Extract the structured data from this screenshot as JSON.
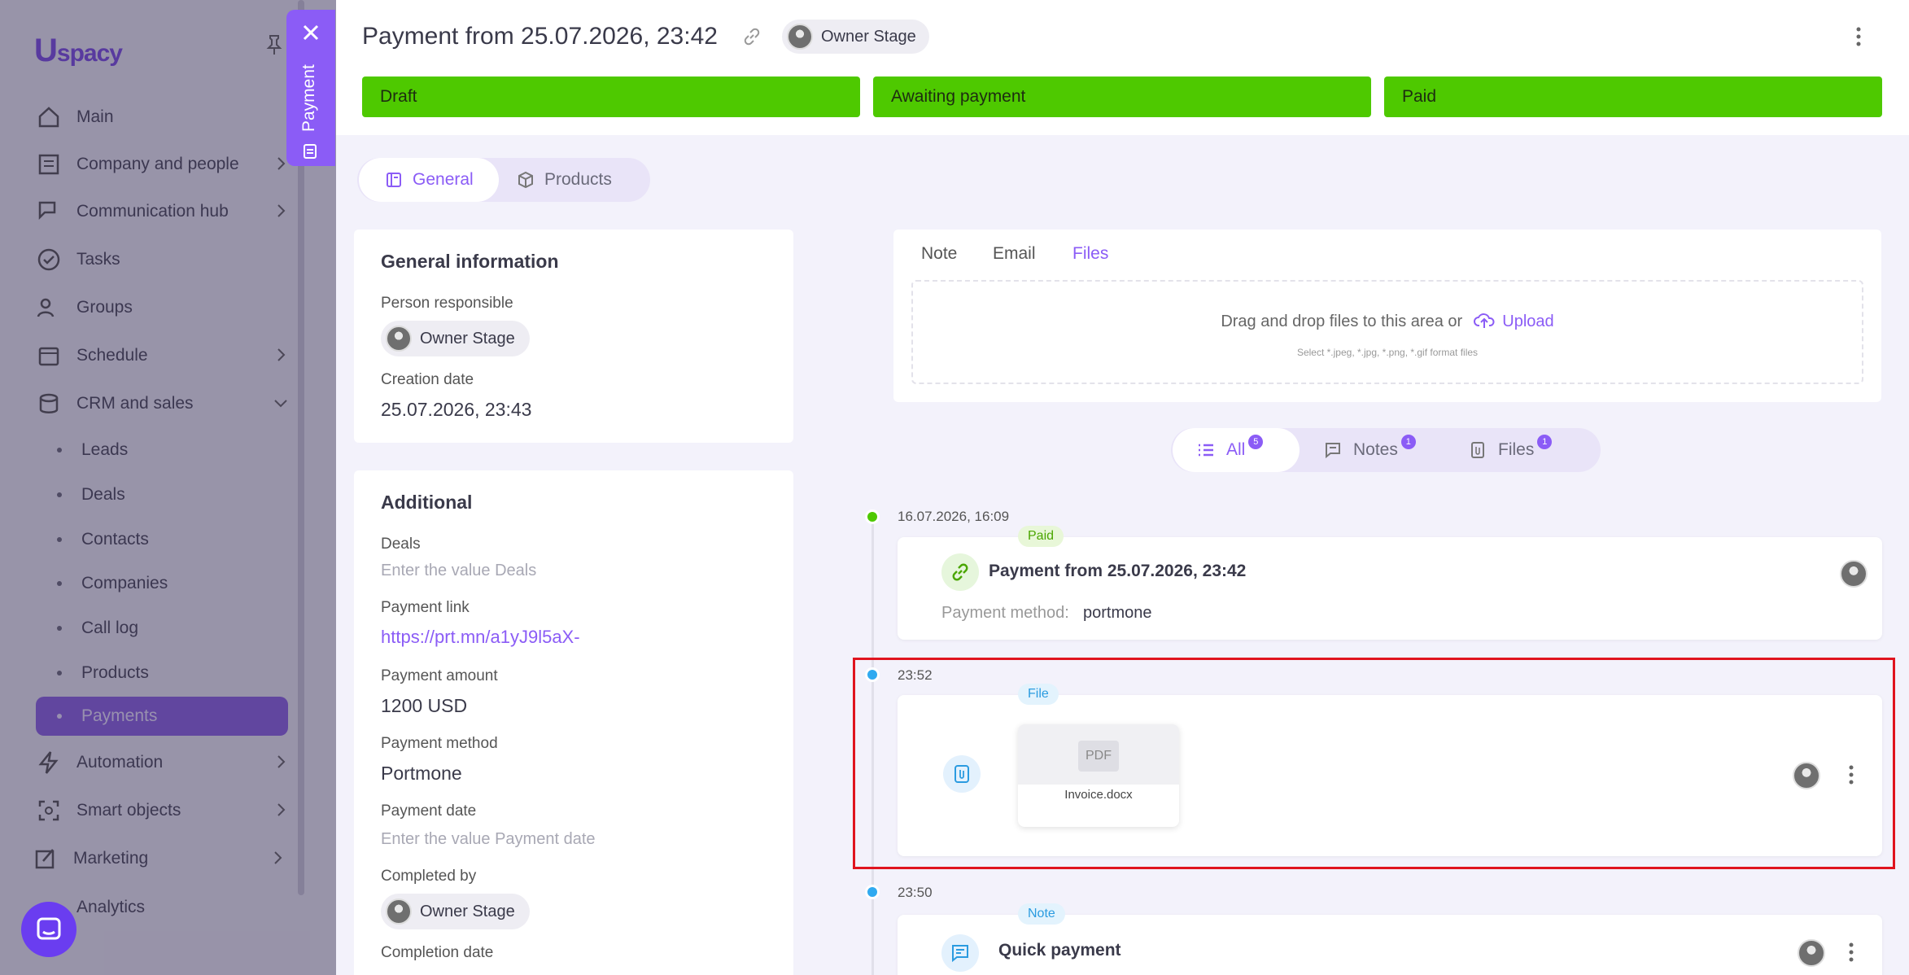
{
  "sidebar": {
    "logo": "spacy",
    "nav": [
      {
        "label": "Main",
        "icon": "home-icon"
      },
      {
        "label": "Company and people",
        "icon": "building-icon"
      },
      {
        "label": "Communication hub",
        "icon": "chat-edit-icon"
      },
      {
        "label": "Tasks",
        "icon": "check-circle-icon"
      },
      {
        "label": "Groups",
        "icon": "people-icon"
      },
      {
        "label": "Schedule",
        "icon": "calendar-icon"
      },
      {
        "label": "CRM and sales",
        "icon": "database-icon"
      }
    ],
    "crm_sub": [
      "Leads",
      "Deals",
      "Contacts",
      "Companies",
      "Call log",
      "Products",
      "Payments"
    ],
    "nav_bottom": [
      {
        "label": "Automation",
        "icon": "lightning-icon"
      },
      {
        "label": "Smart objects",
        "icon": "smart-object-icon"
      },
      {
        "label": "Marketing",
        "icon": "marketing-icon"
      },
      {
        "label": "Analytics",
        "icon": "analytics-icon"
      }
    ]
  },
  "panel_tab": {
    "label": "Payment"
  },
  "header": {
    "title": "Payment from 25.07.2026, 23:42",
    "owner": "Owner Stage",
    "stages": [
      "Draft",
      "Awaiting payment",
      "Paid"
    ],
    "stage_color": "#4ec900"
  },
  "tabs": {
    "general": "General",
    "products": "Products"
  },
  "general_info": {
    "heading": "General information",
    "person_label": "Person responsible",
    "person": "Owner Stage",
    "creation_label": "Creation date",
    "creation_date": "25.07.2026, 23:43"
  },
  "additional": {
    "heading": "Additional",
    "deals_label": "Deals",
    "deals_placeholder": "Enter the value Deals",
    "link_label": "Payment link",
    "link": "https://prt.mn/a1yJ9l5aX-",
    "amount_label": "Payment amount",
    "amount": "1200 USD",
    "method_label": "Payment method",
    "method": "Portmone",
    "date_label": "Payment date",
    "date_placeholder": "Enter the value Payment date",
    "completed_label": "Completed by",
    "completed_by": "Owner Stage",
    "completion_label": "Completion date"
  },
  "composer": {
    "tabs": [
      "Note",
      "Email",
      "Files"
    ],
    "active_tab": "Files",
    "drop_text": "Drag and drop files to this area or",
    "upload": "Upload",
    "hint": "Select *.jpeg, *.jpg, *.png, *.gif format files"
  },
  "filter": {
    "all": {
      "label": "All",
      "count": "5"
    },
    "notes": {
      "label": "Notes",
      "count": "1"
    },
    "files": {
      "label": "Files",
      "count": "1"
    }
  },
  "timeline": [
    {
      "time": "16.07.2026, 16:09",
      "badge": "Paid",
      "title": "Payment from 25.07.2026, 23:42",
      "method_label": "Payment method:",
      "method": "portmone"
    },
    {
      "time": "23:52",
      "badge": "File",
      "file_type": "PDF",
      "file_name": "Invoice.docx"
    },
    {
      "time": "23:50",
      "badge": "Note",
      "title": "Quick payment"
    }
  ],
  "colors": {
    "accent": "#8b5cf6",
    "stage_green": "#4ec900",
    "highlight": "#e0141e",
    "dot_green": "#4ec900",
    "dot_blue": "#30aaf0"
  }
}
